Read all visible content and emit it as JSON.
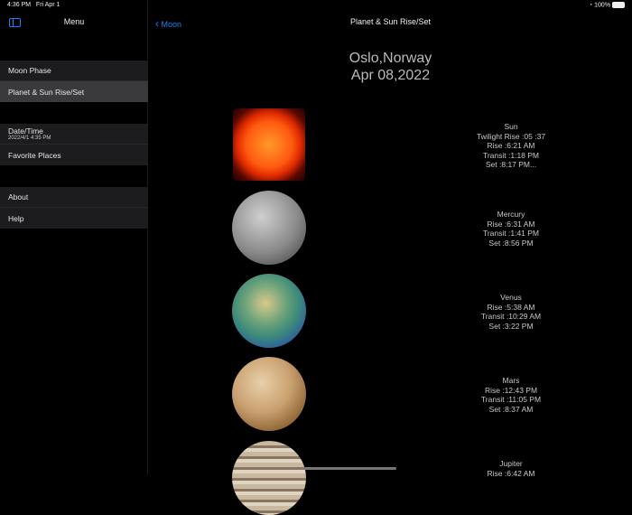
{
  "status": {
    "time": "4:36 PM",
    "date": "Fri Apr 1",
    "battery": "100%"
  },
  "sidebar": {
    "title": "Menu",
    "groups": [
      [
        {
          "label": "Moon Phase"
        },
        {
          "label": "Planet & Sun Rise/Set",
          "selected": true
        }
      ],
      [
        {
          "label": "Date/Time",
          "sub": "2022/4/1 4:35 PM"
        },
        {
          "label": "Favorite Places"
        }
      ],
      [
        {
          "label": "About"
        },
        {
          "label": "Help"
        }
      ]
    ]
  },
  "nav": {
    "back": "Moon",
    "title": "Planet & Sun Rise/Set"
  },
  "location": {
    "place": "Oslo,Norway",
    "date": "Apr 08,2022"
  },
  "bodies": [
    {
      "name": "Sun",
      "lines": [
        "Twilight Rise :05 :37",
        "Rise :6:21 AM",
        "Transit :1:18 PM",
        "Set :8:17 PM..."
      ]
    },
    {
      "name": "Mercury",
      "lines": [
        "Rise :6:31 AM",
        "Transit :1:41 PM",
        "Set :8:56 PM"
      ]
    },
    {
      "name": "Venus",
      "lines": [
        "Rise :5:38 AM",
        "Transit :10:29 AM",
        "Set :3:22 PM"
      ]
    },
    {
      "name": "Mars",
      "lines": [
        "Rise :12:43 PM",
        "Transit :11:05 PM",
        "Set :8:37 AM"
      ]
    },
    {
      "name": "Jupiter",
      "lines": [
        "Rise :6:42 AM"
      ]
    }
  ]
}
